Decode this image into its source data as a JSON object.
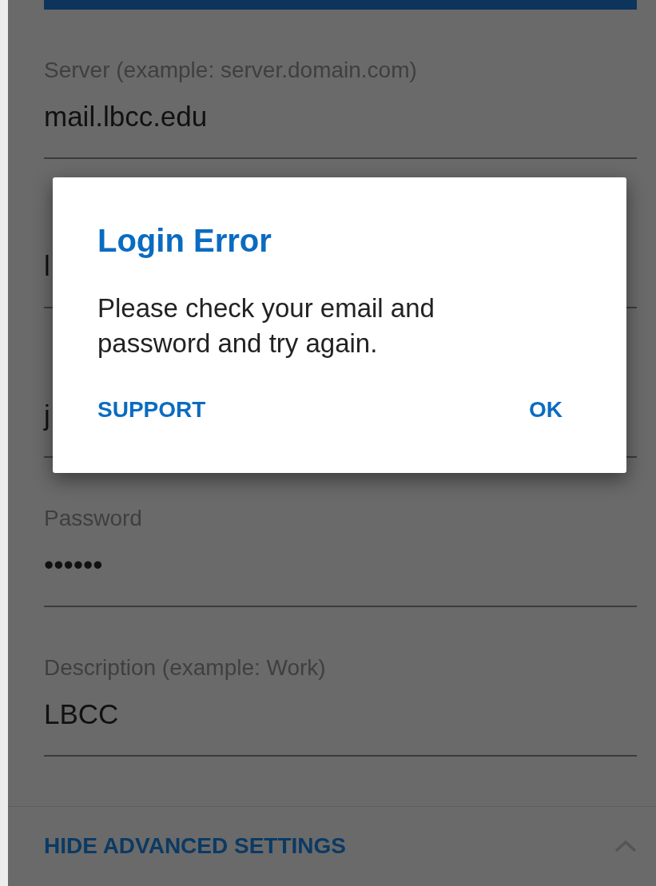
{
  "fields": [
    {
      "label": "Server (example: server.domain.com)",
      "value": "mail.lbcc.edu"
    },
    {
      "value": "l"
    },
    {
      "value": "j"
    },
    {
      "label": "Password",
      "value": "••••••"
    },
    {
      "label": "Description (example: Work)",
      "value": "LBCC"
    }
  ],
  "advanced_toggle": {
    "label": "HIDE ADVANCED SETTINGS",
    "expanded": true
  },
  "dialog": {
    "title": "Login Error",
    "message": "Please check your email and password and try again.",
    "buttons": [
      "SUPPORT",
      "OK"
    ]
  }
}
